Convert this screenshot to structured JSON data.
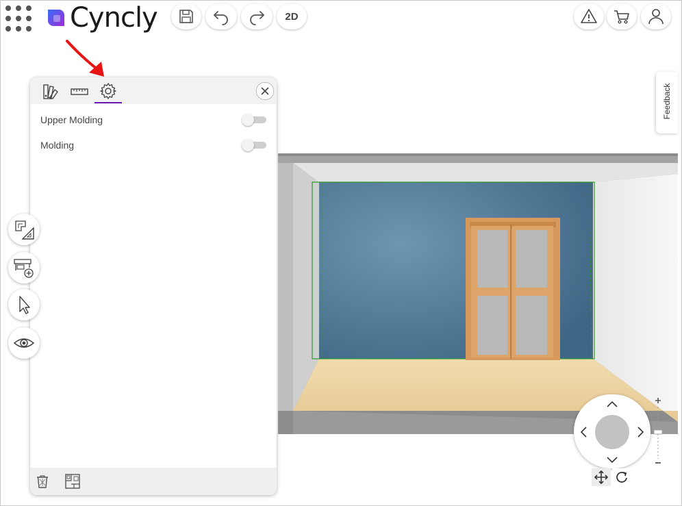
{
  "app": {
    "logo_text": "Cyncly",
    "brand_color": "#6a1bb0"
  },
  "toolbar": {
    "apps_icon": "grid-dots-icon",
    "save_icon": "save-icon",
    "undo_icon": "undo-icon",
    "redo_icon": "redo-icon",
    "view_toggle_label": "2D",
    "warning_icon": "warning-icon",
    "cart_icon": "cart-icon",
    "user_icon": "user-icon"
  },
  "panel": {
    "tabs": [
      {
        "name": "materials",
        "icon": "palette-icon",
        "active": false
      },
      {
        "name": "dimensions",
        "icon": "ruler-icon",
        "active": false
      },
      {
        "name": "settings",
        "icon": "gear-icon",
        "active": true
      }
    ],
    "settings": [
      {
        "label": "Upper Molding",
        "enabled": false
      },
      {
        "label": "Molding",
        "enabled": false
      }
    ],
    "footer_icons": [
      "trash-icon",
      "floorplan-icon"
    ]
  },
  "side_tools": [
    "room-plan-icon",
    "add-cabinet-icon",
    "pointer-icon",
    "eye-icon"
  ],
  "feedback": {
    "label": "Feedback"
  },
  "navigation": {
    "modes": [
      "move-icon",
      "rotate-icon"
    ],
    "zoom_plus": "+",
    "zoom_minus": "−"
  },
  "colors": {
    "wall": "#4f7795",
    "floor": "#e8cf9e",
    "door_frame": "#d79a5c",
    "selection": "#2e9a2e",
    "annotation_arrow": "#e81414"
  }
}
